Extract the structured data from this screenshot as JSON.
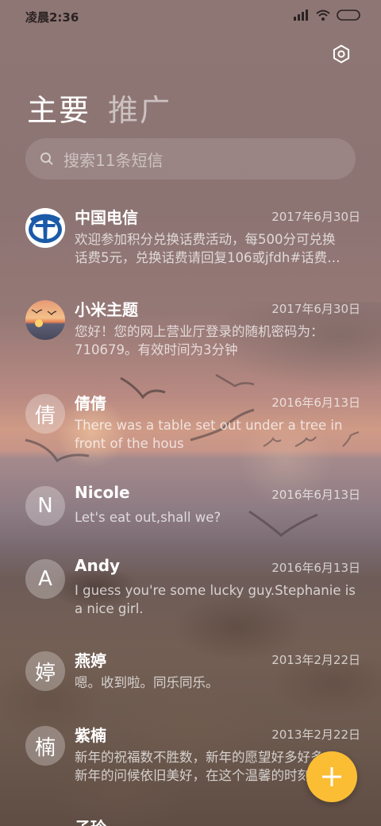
{
  "status_bar": {
    "time": "凌晨2:36",
    "battery_icon": "battery-icon",
    "wifi_icon": "wifi-icon",
    "signal_icon": "signal-icon"
  },
  "header": {
    "settings_icon": "gear-icon"
  },
  "tabs": [
    {
      "label": "主要",
      "active": true
    },
    {
      "label": "推广",
      "active": false
    }
  ],
  "search": {
    "icon": "search-icon",
    "placeholder": "搜索11条短信"
  },
  "messages": [
    {
      "sender": "中国电信",
      "date": "2017年6月30日",
      "preview": "欢迎参加积分兑换话费活动，每500分可兑换\n话费5元，兑换话费请回复106或jfdh#话费…",
      "avatar": "china-telecom-logo"
    },
    {
      "sender": "小米主题",
      "date": "2017年6月30日",
      "preview": "您好！您的网上营业厅登录的随机密码为：\n710679。有效时间为3分钟",
      "avatar": "sunset-photo"
    },
    {
      "sender": "倩倩",
      "date": "2016年6月13日",
      "preview": "There was a table set out under a tree in\nfront of the hous",
      "avatar_text": "倩"
    },
    {
      "sender": "Nicole",
      "date": "2016年6月13日",
      "preview": "Let's eat out,shall we?",
      "avatar_text": "N"
    },
    {
      "sender": "Andy",
      "date": "2016年6月13日",
      "preview": "I guess you're some lucky guy.Stephanie is\na nice girl.",
      "avatar_text": "A"
    },
    {
      "sender": "燕婷",
      "date": "2013年2月22日",
      "preview": "嗯。收到啦。同乐同乐。",
      "avatar_text": "婷"
    },
    {
      "sender": "紫楠",
      "date": "2013年2月22日",
      "preview": "新年的祝福数不胜数，新年的愿望好多好多，\n新年的问候依旧美好，在这个温馨的时刻…",
      "avatar_text": "楠"
    },
    {
      "sender": "子玲",
      "date": "",
      "preview": "",
      "avatar_text": ""
    }
  ],
  "fab": {
    "icon": "plus-icon",
    "color": "#fbbd34"
  },
  "colors": {
    "accent": "#fbbd34",
    "telecom_blue": "#1b5aa8"
  }
}
